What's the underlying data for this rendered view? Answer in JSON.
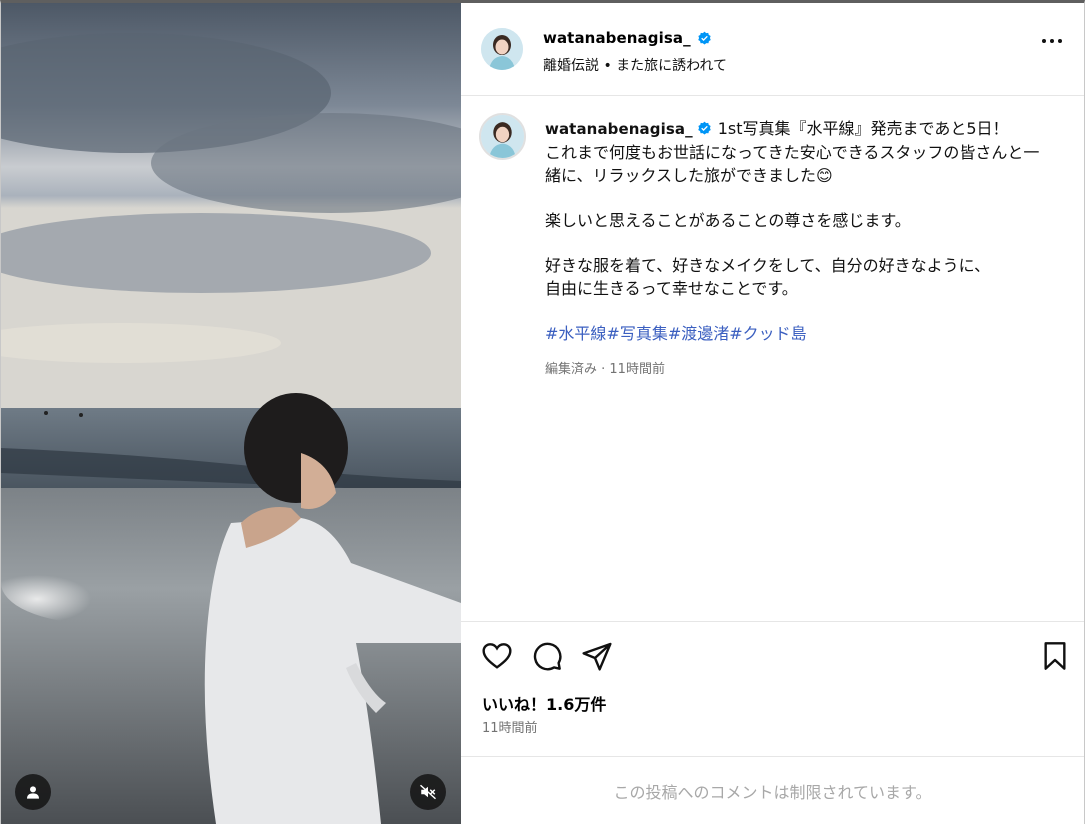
{
  "post": {
    "username": "watanabenagisa_",
    "verified": true,
    "audio_subtitle": "離婚伝説 • また旅に誘われて",
    "caption_line1": "1st写真集『水平線』発売まであと5日！",
    "caption_line2": "これまで何度もお世話になってきた安心できるスタッフの皆さんと一緒に、リラックスした旅ができました😊",
    "caption_para2": "楽しいと思えることがあることの尊さを感じます。",
    "caption_para3a": "好きな服を着て、好きなメイクをして、自分の好きなように、",
    "caption_para3b": "自由に生きるって幸せなことです。",
    "hashtags": [
      "#水平線",
      "#写真集",
      "#渡邊渚",
      "#クッド島"
    ],
    "caption_meta": "編集済み · 11時間前",
    "likes": "いいね！1.6万件",
    "posted_time": "11時間前",
    "comments_restricted": "この投稿へのコメントは制限されています。"
  },
  "icons": {
    "more": "more-options-icon",
    "like": "heart-icon",
    "comment": "comment-icon",
    "share": "share-icon",
    "save": "bookmark-icon",
    "user_tags": "user-icon",
    "mute": "muted-speaker-icon",
    "verified": "verified-badge-icon"
  },
  "colors": {
    "verified": "#0095f6",
    "hashtag": "#3b5fc0",
    "muted_text": "#737373",
    "restricted_text": "#a8a8a8"
  }
}
